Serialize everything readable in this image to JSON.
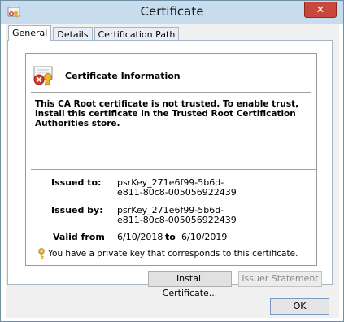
{
  "window": {
    "title": "Certificate",
    "close_label": "✕"
  },
  "tabs": [
    {
      "label": "General",
      "active": true
    },
    {
      "label": "Details",
      "active": false
    },
    {
      "label": "Certification Path",
      "active": false
    }
  ],
  "certificate": {
    "header": "Certificate Information",
    "warning": "This CA Root certificate is not trusted. To enable trust, install this certificate in the Trusted Root Certification Authorities store.",
    "issued_to_label": "Issued to:",
    "issued_to_line1": "psrKey_271e6f99-5b6d-",
    "issued_to_line2": "e811-80c8-005056922439",
    "issued_by_label": "Issued by:",
    "issued_by_line1": "psrKey_271e6f99-5b6d-",
    "issued_by_line2": "e811-80c8-005056922439",
    "valid_from_label": "Valid from",
    "valid_from": "6/10/2018",
    "valid_to_label": "to",
    "valid_to": "6/10/2019",
    "private_key_note": "You have a private key that corresponds to this certificate."
  },
  "buttons": {
    "install": "Install Certificate...",
    "issuer_statement": "Issuer Statement",
    "ok": "OK"
  },
  "colors": {
    "titlebar": "#c7ddee",
    "close": "#c9483d",
    "client_bg": "#f0f0f0"
  }
}
